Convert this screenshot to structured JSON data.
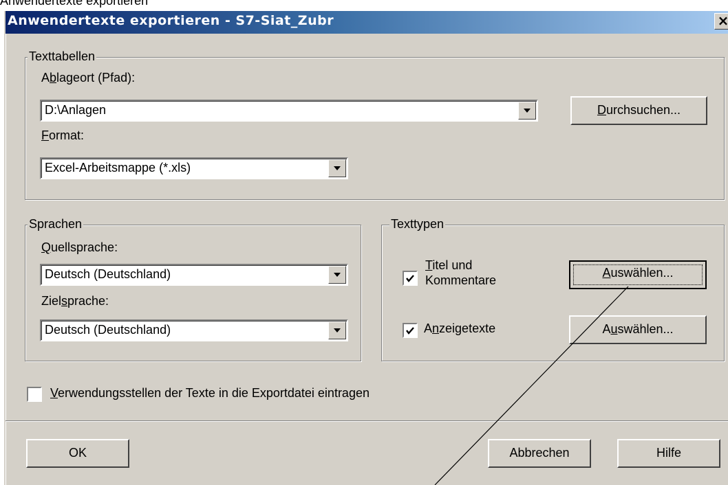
{
  "top_strip_text": "Anwendertexte exportieren",
  "window": {
    "title": "Anwendertexte exportieren - S7-Siat_Zubr",
    "close_glyph": "×"
  },
  "texttabellen": {
    "legend": "Texttabellen",
    "ablageort_label": {
      "before": "A",
      "key": "b",
      "after": "lageort (Pfad):"
    },
    "ablageort_value": "D:\\Anlagen",
    "durchsuchen_button": {
      "before": "",
      "key": "D",
      "after": "urchsuchen..."
    },
    "format_label": {
      "before": "",
      "key": "F",
      "after": "ormat:"
    },
    "format_value": "Excel-Arbeitsmappe (*.xls)"
  },
  "sprachen": {
    "legend": "Sprachen",
    "quellsprache_label": {
      "before": "",
      "key": "Q",
      "after": "uellsprache:"
    },
    "quellsprache_value": "Deutsch (Deutschland)",
    "zielsprache_label": {
      "before": "Ziel",
      "key": "s",
      "after": "prache:"
    },
    "zielsprache_value": "Deutsch (Deutschland)"
  },
  "texttypen": {
    "legend": "Texttypen",
    "titel_checkbox": {
      "checked": true,
      "line1_before": "",
      "line1_key": "T",
      "line1_after": "itel und",
      "line2": "Kommentare"
    },
    "titel_button": {
      "before": "",
      "key": "A",
      "after": "uswählen..."
    },
    "anzeige_checkbox": {
      "checked": true,
      "before": "A",
      "key": "n",
      "after": "zeigetexte"
    },
    "anzeige_button": {
      "before": "A",
      "key": "u",
      "after": "swählen..."
    }
  },
  "verwendung_checkbox": {
    "checked": false,
    "before": "",
    "key": "V",
    "after": "erwendungsstellen der Texte in die Exportdatei eintragen"
  },
  "footer": {
    "ok_label": "OK",
    "abbrechen_label": "Abbrechen",
    "hilfe_label": "Hilfe"
  },
  "colors": {
    "dialog_face": "#d4d0c8",
    "titlebar_start": "#0a246a",
    "titlebar_end": "#a6caf0"
  },
  "icons": {
    "combo_arrow": "chevron-down-icon",
    "check": "check-icon"
  }
}
